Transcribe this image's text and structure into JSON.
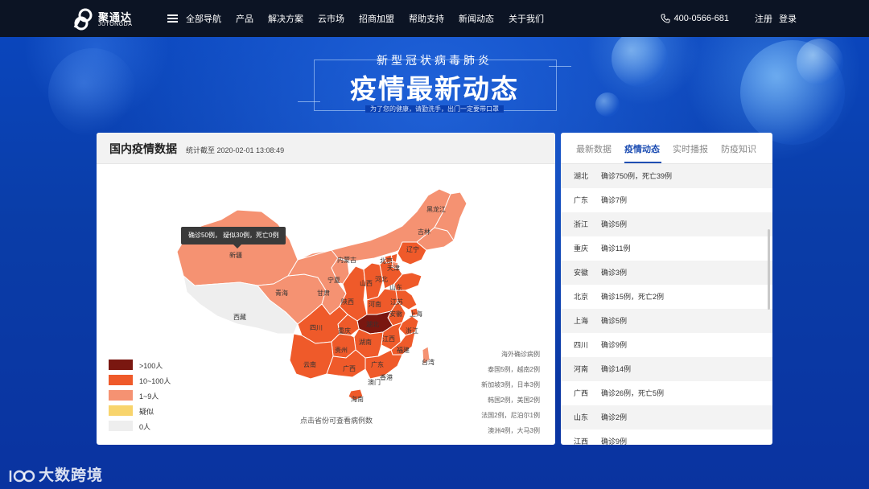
{
  "brand": {
    "name_cn": "聚通达",
    "name_en": "JUTONGDA"
  },
  "nav": {
    "items": [
      "全部导航",
      "产品",
      "解决方案",
      "云市场",
      "招商加盟",
      "帮助支持",
      "新闻动态",
      "关于我们"
    ],
    "phone": "400-0566-681",
    "register": "注册",
    "login": "登录"
  },
  "hero": {
    "subtitle": "新型冠状病毒肺炎",
    "title": "疫情最新动态",
    "tagline": "为了您的健康，请勤洗手，出门一定要带口罩"
  },
  "map_panel": {
    "title": "国内疫情数据",
    "timestamp": "统计截至 2020-02-01 13:08:49",
    "tooltip": "确诊50例， 疑似30例，死亡0例",
    "hint": "点击省份可查看病例数",
    "legend": [
      {
        "label": ">100人",
        "color": "#7a1710"
      },
      {
        "label": "10~100人",
        "color": "#ef5a2a"
      },
      {
        "label": "1~9人",
        "color": "#f59272"
      },
      {
        "label": "疑似",
        "color": "#f8d46c"
      },
      {
        "label": "0人",
        "color": "#eeeeee"
      }
    ],
    "overseas": [
      "海外确诊病例",
      "泰国5例，越南2例",
      "新加坡3例，日本3例",
      "韩国2例，美国2例",
      "法国2例，尼泊尔1例",
      "澳洲4例，大马3例"
    ],
    "provinces": [
      "黑龙江",
      "吉林",
      "辽宁",
      "内蒙古",
      "北京",
      "天津",
      "河北",
      "新疆",
      "宁夏",
      "山西",
      "山东",
      "青海",
      "甘肃",
      "陕西",
      "河南",
      "江苏",
      "西藏",
      "安徽",
      "上海",
      "四川",
      "重庆",
      "湖北",
      "浙江",
      "贵州",
      "湖南",
      "江西",
      "福建",
      "云南",
      "广西",
      "广东",
      "台湾",
      "香港",
      "澳门",
      "海南"
    ]
  },
  "side_panel": {
    "tabs": [
      "最新数据",
      "疫情动态",
      "实时播报",
      "防疫知识"
    ],
    "active_tab": "疫情动态",
    "rows": [
      {
        "province": "湖北",
        "info": "确诊750例，死亡39例"
      },
      {
        "province": "广东",
        "info": "确诊7例"
      },
      {
        "province": "浙江",
        "info": "确诊5例"
      },
      {
        "province": "重庆",
        "info": "确诊11例"
      },
      {
        "province": "安徽",
        "info": "确诊3例"
      },
      {
        "province": "北京",
        "info": "确诊15例，死亡2例"
      },
      {
        "province": "上海",
        "info": "确诊5例"
      },
      {
        "province": "四川",
        "info": "确诊9例"
      },
      {
        "province": "河南",
        "info": "确诊14例"
      },
      {
        "province": "广西",
        "info": "确诊26例，死亡5例"
      },
      {
        "province": "山东",
        "info": "确诊2例"
      },
      {
        "province": "江西",
        "info": "确诊9例"
      }
    ]
  },
  "watermark": "大数跨境"
}
